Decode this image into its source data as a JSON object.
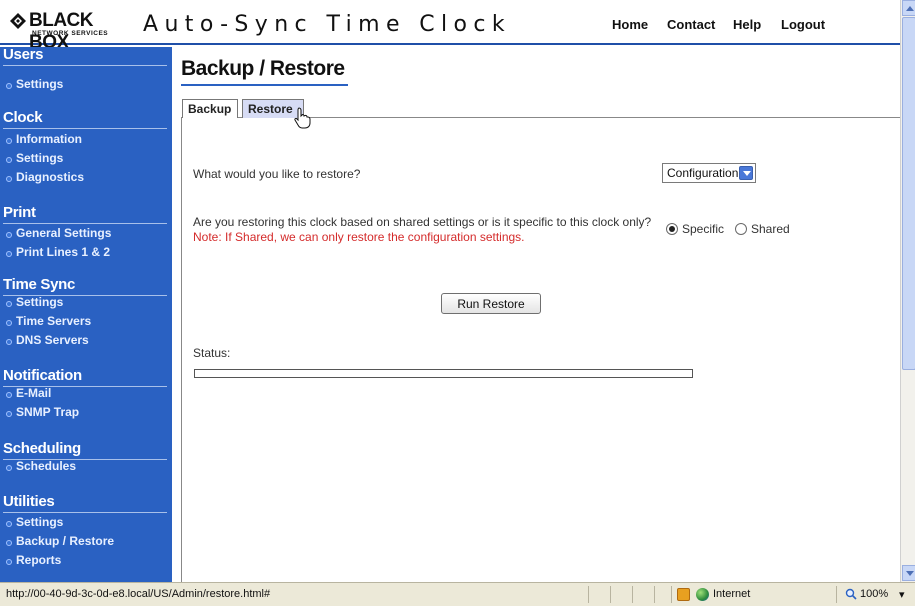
{
  "header": {
    "logo_brand": "BLACK BOX",
    "logo_sub": "NETWORK SERVICES",
    "app_title": "Auto-Sync Time Clock",
    "nav": [
      "Home",
      "Contact",
      "Help",
      "Logout"
    ]
  },
  "sidebar": {
    "sections": [
      {
        "title": "Users",
        "items": [
          "Settings"
        ]
      },
      {
        "title": "Clock",
        "items": [
          "Information",
          "Settings",
          "Diagnostics"
        ]
      },
      {
        "title": "Print",
        "items": [
          "General Settings",
          "Print Lines 1 & 2"
        ]
      },
      {
        "title": "Time Sync",
        "items": [
          "Settings",
          "Time Servers",
          "DNS Servers"
        ]
      },
      {
        "title": "Notification",
        "items": [
          "E-Mail",
          "SNMP Trap"
        ]
      },
      {
        "title": "Scheduling",
        "items": [
          "Schedules"
        ]
      },
      {
        "title": "Utilities",
        "items": [
          "Settings",
          "Backup / Restore",
          "Reports"
        ]
      }
    ]
  },
  "page": {
    "title": "Backup / Restore",
    "tabs": [
      {
        "label": "Backup",
        "active": false
      },
      {
        "label": "Restore",
        "active": true
      }
    ]
  },
  "form": {
    "restore_question": "What would you like to restore?",
    "restore_select_value": "Configuration",
    "scope_question": "Are you restoring this clock based on shared settings or is it specific to this clock only?",
    "scope_note": "Note: If Shared, we can only restore the configuration settings.",
    "scope_options": [
      {
        "label": "Specific",
        "checked": true
      },
      {
        "label": "Shared",
        "checked": false
      }
    ],
    "run_button": "Run Restore",
    "status_label": "Status:",
    "progress_fraction": 0
  },
  "statusbar": {
    "url": "http://00-40-9d-3c-0d-e8.local/US/Admin/restore.html#",
    "zone": "Internet",
    "zoom": "100%"
  },
  "colors": {
    "sidebar_bg": "#2a61c2",
    "active_tab_bg": "#d7dcf5",
    "note_red": "#d42b2b"
  },
  "icons": [
    "black-box-logo-icon",
    "hand-cursor-icon",
    "dropdown-arrow-icon",
    "zone-warning-icon",
    "internet-globe-icon",
    "zoom-icon",
    "scroll-up-icon",
    "scroll-down-icon"
  ]
}
